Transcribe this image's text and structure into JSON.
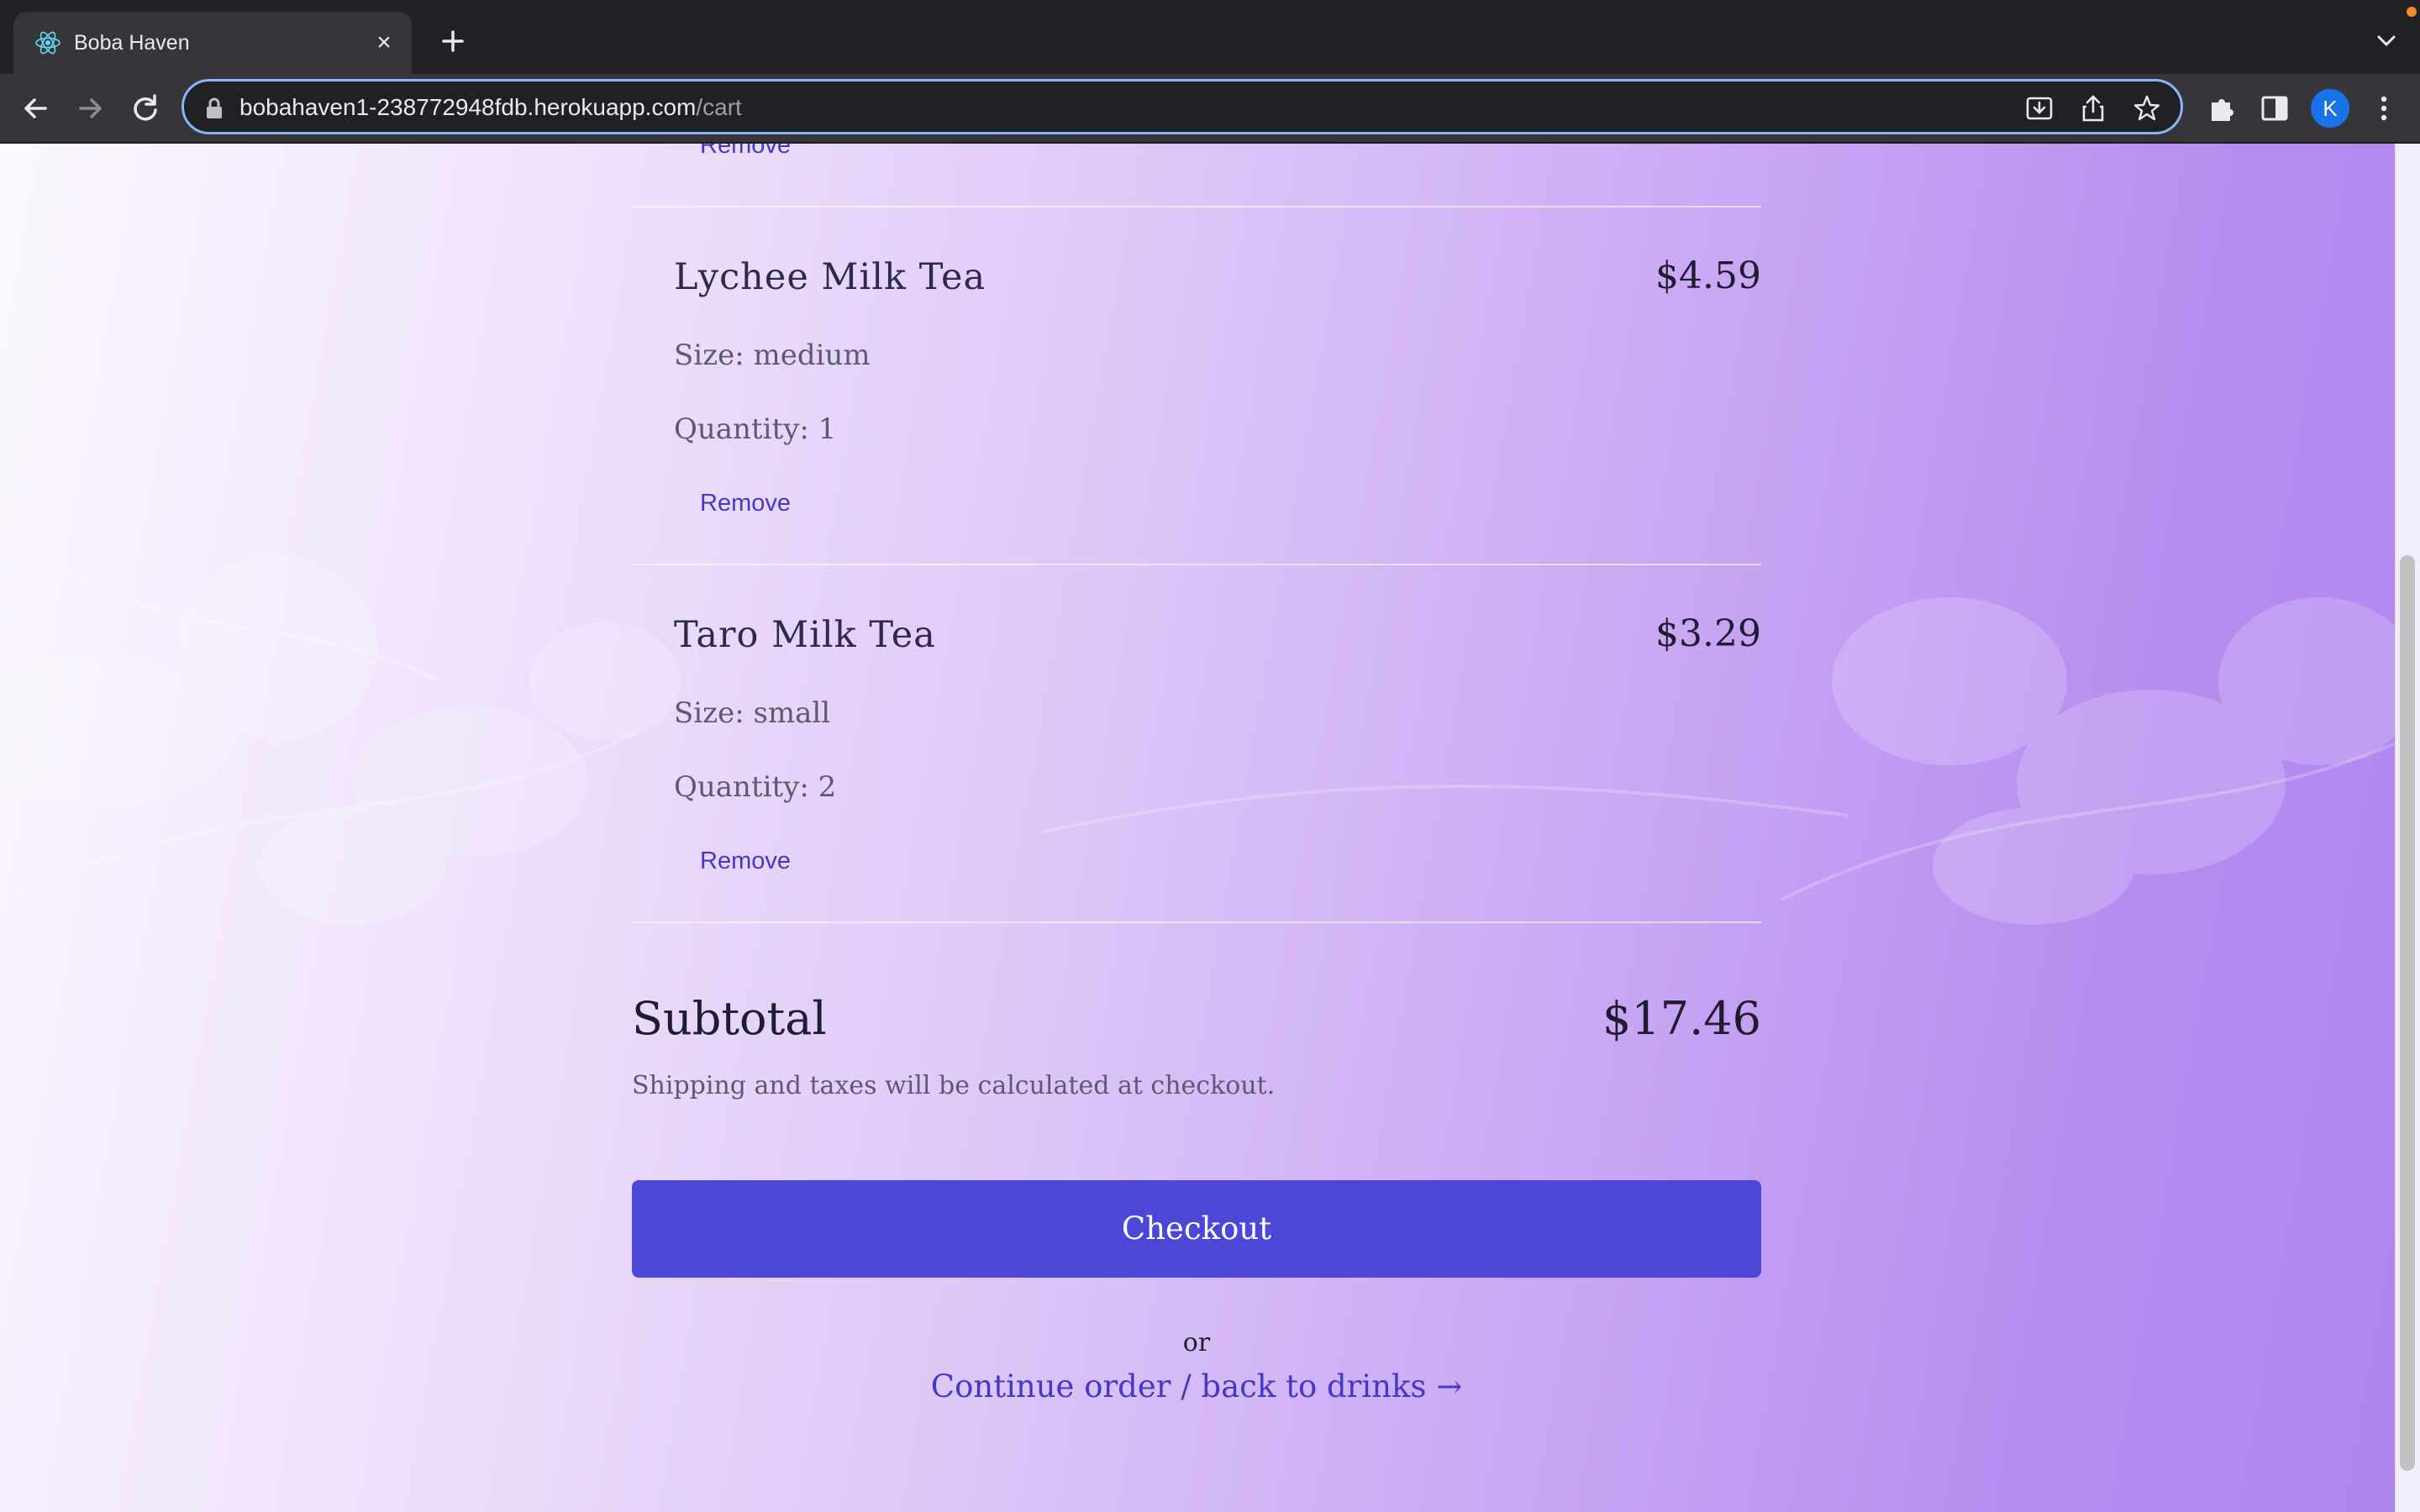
{
  "browser": {
    "tab_title": "Boba Haven",
    "url_host": "bobahaven1-238772948fdb.herokuapp.com",
    "url_path": "/cart",
    "profile_initial": "K"
  },
  "cart": {
    "first_remove_label": "Remove",
    "items": [
      {
        "name": "Lychee Milk Tea",
        "price": "$4.59",
        "size": "Size: medium",
        "quantity": "Quantity: 1",
        "remove_label": "Remove"
      },
      {
        "name": "Taro Milk Tea",
        "price": "$3.29",
        "size": "Size: small",
        "quantity": "Quantity: 2",
        "remove_label": "Remove"
      }
    ]
  },
  "summary": {
    "subtotal_label": "Subtotal",
    "subtotal_value": "$17.46",
    "shipping_note": "Shipping and taxes will be calculated at checkout.",
    "checkout_label": "Checkout",
    "or_label": "or",
    "continue_label": "Continue order / back to drinks →"
  },
  "colors": {
    "accent": "#4a47d9",
    "link": "#4338ca",
    "gradient_end": "#ae85ef"
  }
}
